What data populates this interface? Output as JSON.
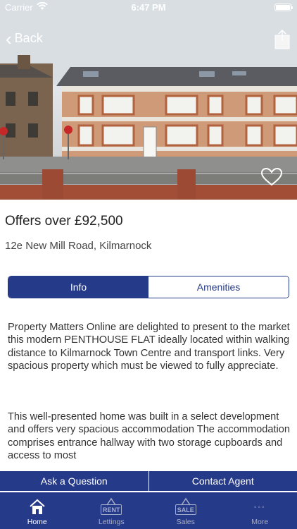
{
  "status_bar": {
    "carrier": "Carrier",
    "time": "6:47 PM"
  },
  "header": {
    "back_label": "Back"
  },
  "listing": {
    "price": "Offers over £92,500",
    "address": "12e New Mill Road, Kilmarnock"
  },
  "segments": [
    {
      "label": "Info",
      "active": true
    },
    {
      "label": "Amenities",
      "active": false
    }
  ],
  "description": [
    "Property Matters Online are delighted to present to the market this modern PENTHOUSE FLAT ideally located within walking distance to Kilmarnock Town Centre and transport links. Very spacious property which must be viewed to fully appreciate.",
    "",
    "This well-presented home was built in a select development and offers very spacious accommodation The accommodation comprises entrance hallway with two storage cupboards and access to most"
  ],
  "actions": {
    "ask_label": "Ask a Question",
    "contact_label": "Contact Agent"
  },
  "tabbar": [
    {
      "label": "Home",
      "icon": "house-icon",
      "active": true
    },
    {
      "label": "Lettings",
      "icon": "rent-sign-icon",
      "sign_text": "RENT",
      "active": false
    },
    {
      "label": "Sales",
      "icon": "sale-sign-icon",
      "sign_text": "SALE",
      "active": false
    },
    {
      "label": "More",
      "icon": "more-dots-icon",
      "active": false
    }
  ],
  "colors": {
    "primary": "#263a8a",
    "inactive_tab": "#a5acc9"
  }
}
